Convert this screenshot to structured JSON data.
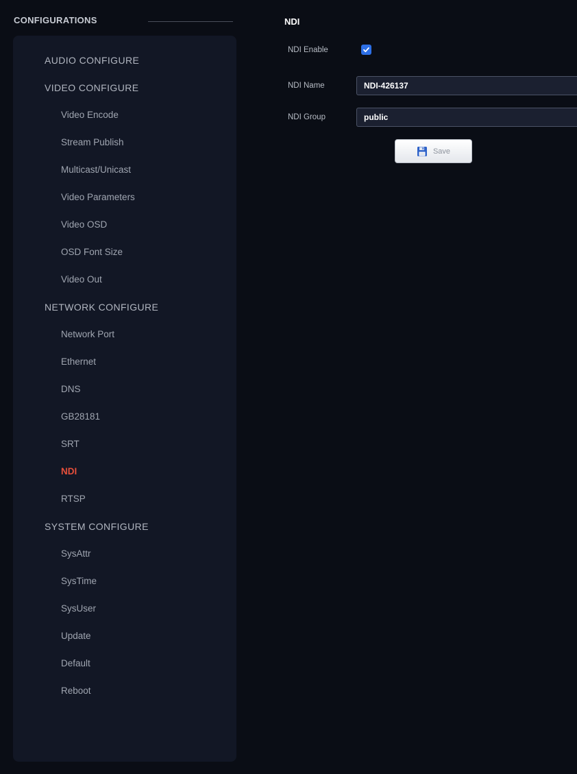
{
  "sidebar": {
    "title": "CONFIGURATIONS",
    "items": [
      {
        "label": "AUDIO CONFIGURE",
        "level": "group",
        "active": false
      },
      {
        "label": "VIDEO CONFIGURE",
        "level": "group",
        "active": false
      },
      {
        "label": "Video Encode",
        "level": "sub",
        "active": false
      },
      {
        "label": "Stream Publish",
        "level": "sub",
        "active": false
      },
      {
        "label": "Multicast/Unicast",
        "level": "sub",
        "active": false
      },
      {
        "label": "Video Parameters",
        "level": "sub",
        "active": false
      },
      {
        "label": "Video OSD",
        "level": "sub",
        "active": false
      },
      {
        "label": "OSD Font Size",
        "level": "sub",
        "active": false
      },
      {
        "label": "Video Out",
        "level": "sub",
        "active": false
      },
      {
        "label": "NETWORK CONFIGURE",
        "level": "group",
        "active": false
      },
      {
        "label": "Network Port",
        "level": "sub",
        "active": false
      },
      {
        "label": "Ethernet",
        "level": "sub",
        "active": false
      },
      {
        "label": "DNS",
        "level": "sub",
        "active": false
      },
      {
        "label": "GB28181",
        "level": "sub",
        "active": false
      },
      {
        "label": "SRT",
        "level": "sub",
        "active": false
      },
      {
        "label": "NDI",
        "level": "sub",
        "active": true
      },
      {
        "label": "RTSP",
        "level": "sub",
        "active": false
      },
      {
        "label": "SYSTEM CONFIGURE",
        "level": "group",
        "active": false
      },
      {
        "label": "SysAttr",
        "level": "sub",
        "active": false
      },
      {
        "label": "SysTime",
        "level": "sub",
        "active": false
      },
      {
        "label": "SysUser",
        "level": "sub",
        "active": false
      },
      {
        "label": "Update",
        "level": "sub",
        "active": false
      },
      {
        "label": "Default",
        "level": "sub",
        "active": false
      },
      {
        "label": "Reboot",
        "level": "sub",
        "active": false
      }
    ]
  },
  "main": {
    "title": "NDI",
    "ndi_enable": {
      "label": "NDI Enable",
      "checked": true
    },
    "ndi_name": {
      "label": "NDI Name",
      "value": "NDI-426137"
    },
    "ndi_group": {
      "label": "NDI Group",
      "value": "public"
    },
    "save_label": "Save"
  },
  "colors": {
    "background": "#0a0d15",
    "sidebar_panel": "#121725",
    "active_item": "#e64f3b",
    "checkbox": "#2d6fe6"
  },
  "icons": {
    "checkbox": "checkmark-icon",
    "save": "floppy-disk-icon"
  }
}
